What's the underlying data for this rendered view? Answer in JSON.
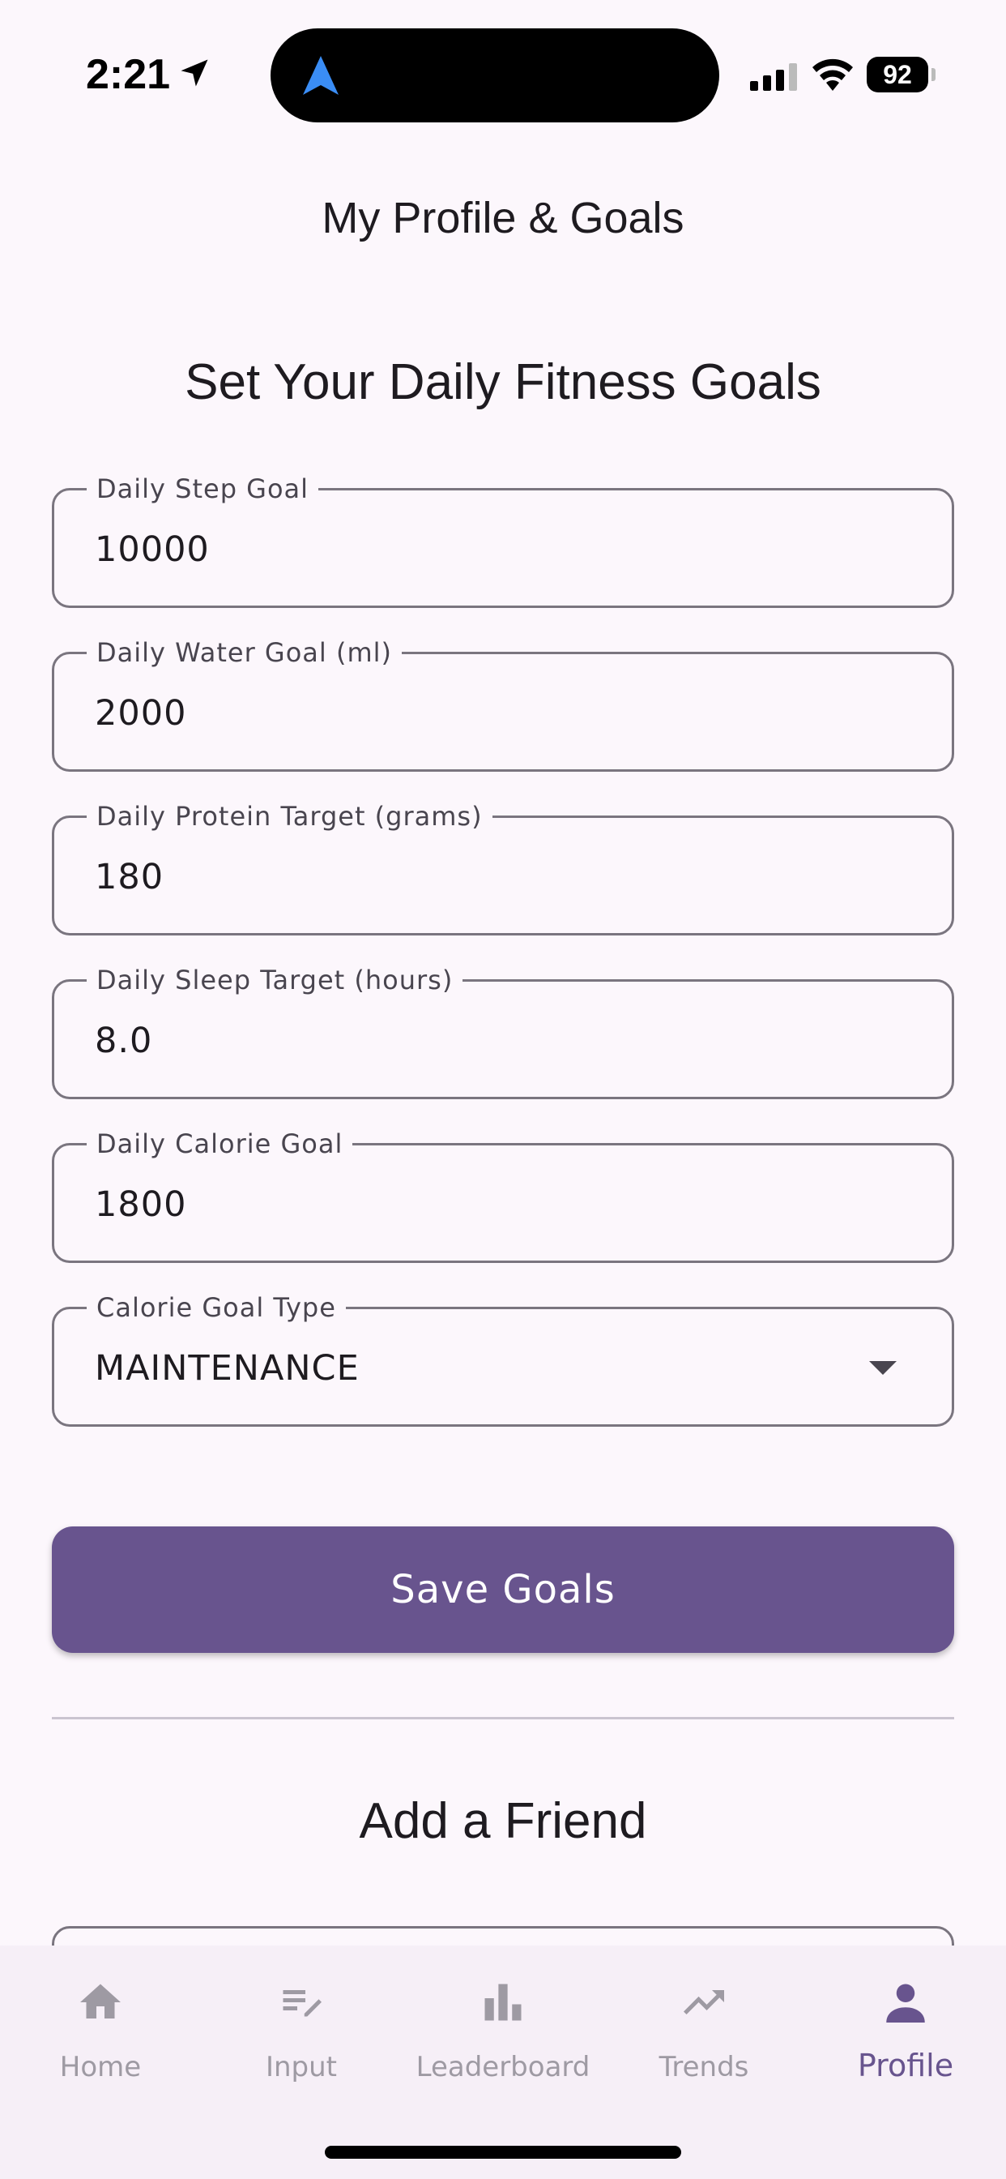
{
  "status_bar": {
    "time": "2:21",
    "battery": "92"
  },
  "app_bar": {
    "title": "My Profile & Goals"
  },
  "goals": {
    "title": "Set Your Daily Fitness Goals",
    "fields": [
      {
        "label": "Daily Step Goal",
        "value": "10000"
      },
      {
        "label": "Daily Water Goal (ml)",
        "value": "2000"
      },
      {
        "label": "Daily Protein Target (grams)",
        "value": "180"
      },
      {
        "label": "Daily Sleep Target (hours)",
        "value": "8.0"
      },
      {
        "label": "Daily Calorie Goal",
        "value": "1800"
      }
    ],
    "calorie_type": {
      "label": "Calorie Goal Type",
      "value": "MAINTENANCE"
    },
    "save_label": "Save Goals"
  },
  "friend": {
    "title": "Add a Friend"
  },
  "bottom_nav": {
    "items": [
      {
        "label": "Home",
        "icon": "home-icon"
      },
      {
        "label": "Input",
        "icon": "edit-list-icon"
      },
      {
        "label": "Leaderboard",
        "icon": "bar-chart-icon"
      },
      {
        "label": "Trends",
        "icon": "trending-up-icon"
      },
      {
        "label": "Profile",
        "icon": "person-icon"
      }
    ],
    "active": "Profile"
  },
  "colors": {
    "background": "#FCF7FC",
    "primary": "#68548E",
    "outline": "#7A757F",
    "inactive_nav": "#9E9AA3"
  }
}
